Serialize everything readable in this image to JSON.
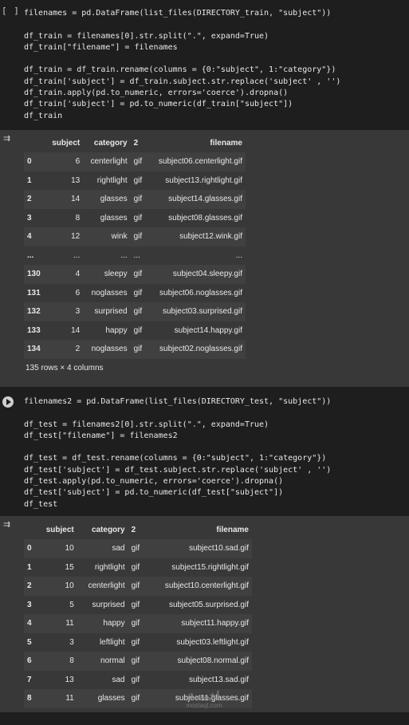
{
  "cell1": {
    "exec_badge": "[ ]",
    "lines": [
      "filenames = pd.DataFrame(list_files(DIRECTORY_train, \"subject\"))",
      "",
      "df_train = filenames[0].str.split(\".\", expand=True)",
      "df_train[\"filename\"] = filenames",
      "",
      "df_train = df_train.rename(columns = {0:\"subject\", 1:\"category\"})",
      "df_train['subject'] = df_train.subject.str.replace('subject' , '')",
      "df_train.apply(pd.to_numeric, errors='coerce').dropna()",
      "df_train['subject'] = pd.to_numeric(df_train[\"subject\"])",
      "df_train"
    ]
  },
  "table1": {
    "columns": [
      "",
      "subject",
      "category",
      "2",
      "filename"
    ],
    "rows": [
      [
        "0",
        "6",
        "centerlight",
        "gif",
        "subject06.centerlight.gif"
      ],
      [
        "1",
        "13",
        "rightlight",
        "gif",
        "subject13.rightlight.gif"
      ],
      [
        "2",
        "14",
        "glasses",
        "gif",
        "subject14.glasses.gif"
      ],
      [
        "3",
        "8",
        "glasses",
        "gif",
        "subject08.glasses.gif"
      ],
      [
        "4",
        "12",
        "wink",
        "gif",
        "subject12.wink.gif"
      ],
      [
        "...",
        "...",
        "...",
        "...",
        "..."
      ],
      [
        "130",
        "4",
        "sleepy",
        "gif",
        "subject04.sleepy.gif"
      ],
      [
        "131",
        "6",
        "noglasses",
        "gif",
        "subject06.noglasses.gif"
      ],
      [
        "132",
        "3",
        "surprised",
        "gif",
        "subject03.surprised.gif"
      ],
      [
        "133",
        "14",
        "happy",
        "gif",
        "subject14.happy.gif"
      ],
      [
        "134",
        "2",
        "noglasses",
        "gif",
        "subject02.noglasses.gif"
      ]
    ],
    "shape": "135 rows × 4 columns"
  },
  "cell2": {
    "lines": [
      "filenames2 = pd.DataFrame(list_files(DIRECTORY_test, \"subject\"))",
      "",
      "df_test = filenames2[0].str.split(\".\", expand=True)",
      "df_test[\"filename\"] = filenames2",
      "",
      "df_test = df_test.rename(columns = {0:\"subject\", 1:\"category\"})",
      "df_test['subject'] = df_test.subject.str.replace('subject' , '')",
      "df_test.apply(pd.to_numeric, errors='coerce').dropna()",
      "df_test['subject'] = pd.to_numeric(df_test[\"subject\"])",
      "df_test"
    ]
  },
  "table2": {
    "columns": [
      "",
      "subject",
      "category",
      "2",
      "filename"
    ],
    "rows": [
      [
        "0",
        "10",
        "sad",
        "gif",
        "subject10.sad.gif"
      ],
      [
        "1",
        "15",
        "rightlight",
        "gif",
        "subject15.rightlight.gif"
      ],
      [
        "2",
        "10",
        "centerlight",
        "gif",
        "subject10.centerlight.gif"
      ],
      [
        "3",
        "5",
        "surprised",
        "gif",
        "subject05.surprised.gif"
      ],
      [
        "4",
        "11",
        "happy",
        "gif",
        "subject11.happy.gif"
      ],
      [
        "5",
        "3",
        "leftlight",
        "gif",
        "subject03.leftlight.gif"
      ],
      [
        "6",
        "8",
        "normal",
        "gif",
        "subject08.normal.gif"
      ],
      [
        "7",
        "13",
        "sad",
        "gif",
        "subject13.sad.gif"
      ],
      [
        "8",
        "11",
        "glasses",
        "gif",
        "subject11.glasses.gif"
      ]
    ]
  },
  "watermark": {
    "top": "لخمسة",
    "bottom": "mostaql.com"
  },
  "icons": {
    "run": "play-icon",
    "output": "output-toggle-icon"
  },
  "colors": {
    "background": "#1e1e1e",
    "output": "#383838",
    "row_alt": "#404040"
  }
}
